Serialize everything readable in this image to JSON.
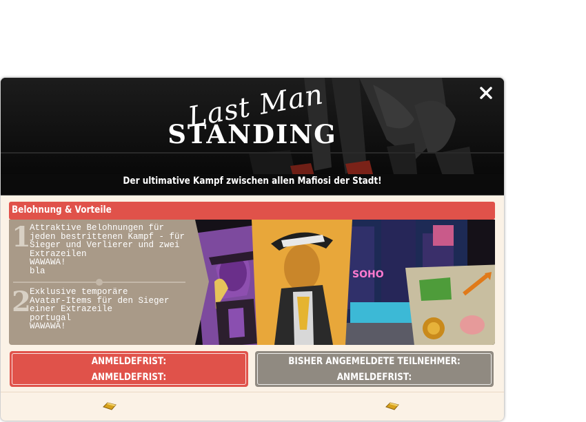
{
  "banner": {
    "title_script": "Last Man",
    "title_main": "STANDING",
    "subtitle": "Der ultimative Kampf zwischen allen Mafiosi der Stadt!",
    "close_symbol": "×"
  },
  "rewards": {
    "header": "Belohnung & Vorteile",
    "items": [
      {
        "number": "1",
        "text": "Attraktive Belohnungen für\njeden bestrittenen Kampf - für\nSieger und Verlierer und zwei\nExtrazeilen\nWAWAWA!\nbla"
      },
      {
        "number": "2",
        "text": "Exklusive temporäre\nAvatar-Items für den Sieger\neiner Extrazeile\nportugal\nWAWAWA!"
      }
    ],
    "billboard_text": "SOHO"
  },
  "status": {
    "left_line1": "ANMELDEFRIST:",
    "left_line2": "ANMELDEFRIST:",
    "right_line1": "BISHER ANGEMELDETE TEILNEHMER:",
    "right_line2": "ANMELDEFRIST:"
  },
  "footer": {
    "left_icon": "gold-bar-icon",
    "right_icon": "gold-bar-icon"
  },
  "colors": {
    "accent_red": "#e0524a",
    "panel_gray": "#a99a88",
    "box_gray": "#908a81",
    "background_cream": "#fbf2e6"
  }
}
